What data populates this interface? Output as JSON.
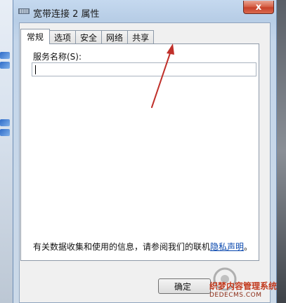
{
  "window": {
    "title": "宽带连接 2 属性",
    "close_glyph": "x"
  },
  "tabs": [
    {
      "label": "常规",
      "active": true
    },
    {
      "label": "选项",
      "active": false
    },
    {
      "label": "安全",
      "active": false
    },
    {
      "label": "网络",
      "active": false
    },
    {
      "label": "共享",
      "active": false
    }
  ],
  "general": {
    "service_name_label": "服务名称(S):",
    "service_name_value": "",
    "info_text": "有关数据收集和使用的信息，请参阅我们的联机",
    "privacy_link": "隐私声明",
    "info_suffix": "。"
  },
  "buttons": {
    "ok_label": "确定"
  },
  "watermark": {
    "site_name": "织梦内容管理系统",
    "domain": "DEDECMS.COM"
  },
  "colors": {
    "arrow": "#c0302a",
    "close_button": "#c7412a",
    "link": "#0645ad"
  }
}
